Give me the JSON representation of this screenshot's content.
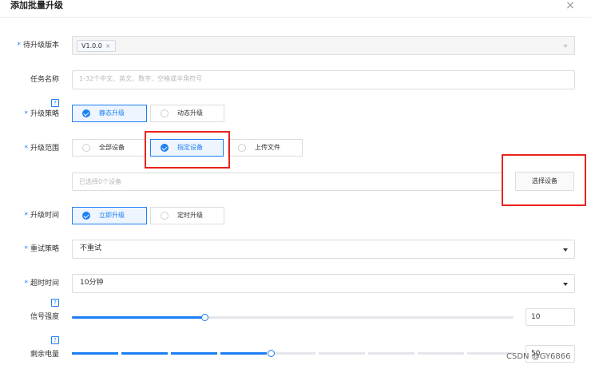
{
  "dialog": {
    "title": "添加批量升级",
    "close_glyph": "×"
  },
  "form": {
    "version": {
      "label": "待升级版本",
      "required": true,
      "tag": "V1.0.0",
      "tag_remove_glyph": "×"
    },
    "task_name": {
      "label": "任务名称",
      "placeholder": "1-32个中文、英文、数字、空格或半角符号"
    },
    "strategy": {
      "label": "升级策略",
      "required": true,
      "help_glyph": "?",
      "options": [
        "静态升级",
        "动态升级"
      ],
      "selected": "静态升级"
    },
    "scope": {
      "label": "升级范围",
      "required": true,
      "options": [
        "全部设备",
        "指定设备",
        "上传文件"
      ],
      "selected": "指定设备"
    },
    "device_select": {
      "placeholder": "已选择0个设备",
      "button_label": "选择设备"
    },
    "time": {
      "label": "升级时间",
      "required": true,
      "options": [
        "立即升级",
        "定时升级"
      ],
      "selected": "立即升级"
    },
    "retry": {
      "label": "重试策略",
      "required": true,
      "value": "不重试"
    },
    "timeout": {
      "label": "超时时间",
      "required": true,
      "value": "10分钟"
    },
    "signal": {
      "label": "信号强度",
      "help_glyph": "?",
      "value": "10",
      "slider_fraction": 0.3
    },
    "battery": {
      "label": "剩余电量",
      "help_glyph": "?",
      "value": "50",
      "slider_fraction": 0.45
    }
  },
  "watermark": "CSDN @GY6866",
  "colors": {
    "accent": "#1d7ff5",
    "highlight_red": "#e8231c"
  }
}
